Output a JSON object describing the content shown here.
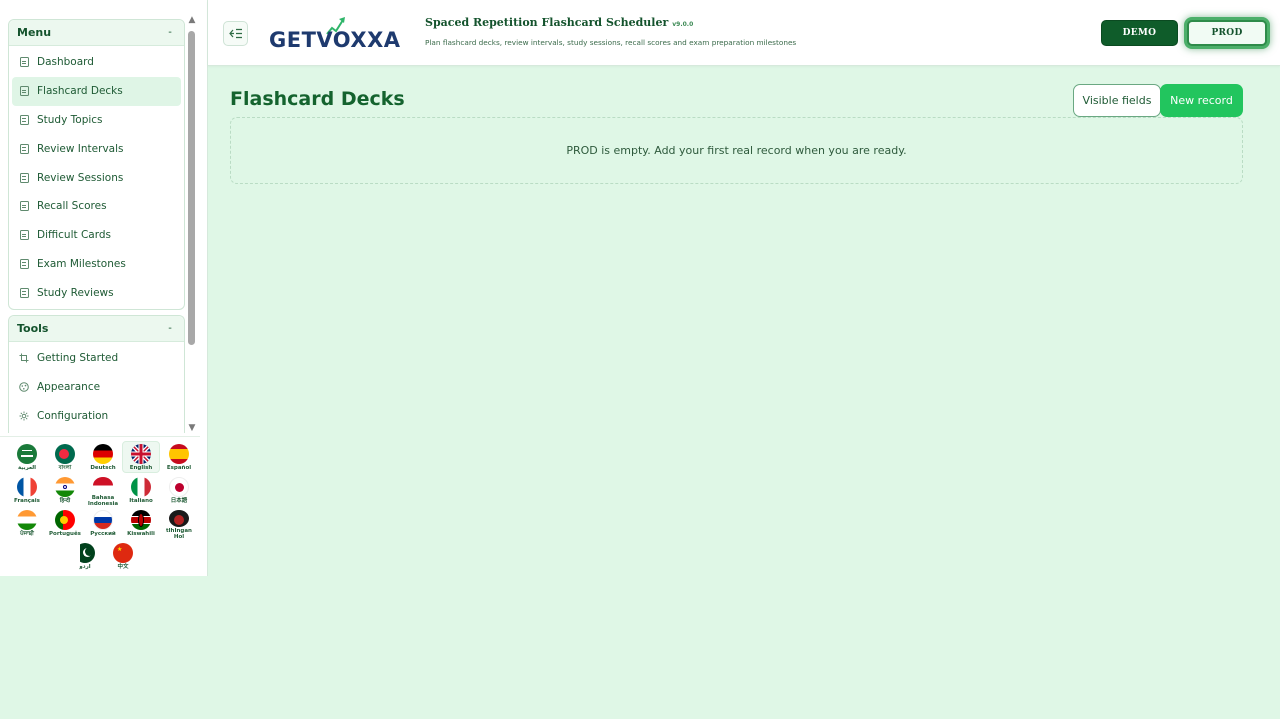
{
  "sidebar": {
    "menu": {
      "title": "Menu",
      "toggle": "-",
      "items": [
        {
          "label": "Dashboard"
        },
        {
          "label": "Flashcard Decks",
          "active": true
        },
        {
          "label": "Study Topics"
        },
        {
          "label": "Review Intervals"
        },
        {
          "label": "Review Sessions"
        },
        {
          "label": "Recall Scores"
        },
        {
          "label": "Difficult Cards"
        },
        {
          "label": "Exam Milestones"
        },
        {
          "label": "Study Reviews"
        }
      ]
    },
    "tools": {
      "title": "Tools",
      "toggle": "-",
      "items": [
        {
          "label": "Getting Started",
          "icon": "crop-icon"
        },
        {
          "label": "Appearance",
          "icon": "palette-icon"
        },
        {
          "label": "Configuration",
          "icon": "gear-icon"
        }
      ]
    },
    "languages": [
      {
        "name": "العربية",
        "code": "ar"
      },
      {
        "name": "বাংলা",
        "code": "bn"
      },
      {
        "name": "Deutsch",
        "code": "de"
      },
      {
        "name": "English",
        "code": "en",
        "selected": true
      },
      {
        "name": "Español",
        "code": "es"
      },
      {
        "name": "Français",
        "code": "fr"
      },
      {
        "name": "हिन्दी",
        "code": "hi"
      },
      {
        "name": "Bahasa Indonesia",
        "code": "id"
      },
      {
        "name": "Italiano",
        "code": "it"
      },
      {
        "name": "日本語",
        "code": "ja"
      },
      {
        "name": "ਪੰਜਾਬੀ",
        "code": "pa"
      },
      {
        "name": "Português",
        "code": "pt"
      },
      {
        "name": "Русский",
        "code": "ru"
      },
      {
        "name": "Kiswahili",
        "code": "sw"
      },
      {
        "name": "tlhIngan Hol",
        "code": "tlh"
      },
      {
        "name": "اردو",
        "code": "ur"
      },
      {
        "name": "中文",
        "code": "zh"
      }
    ]
  },
  "header": {
    "logo_text": "GETVOXXA",
    "app_title": "Spaced Repetition Flashcard Scheduler",
    "app_version": "v9.0.0",
    "app_subtitle": "Plan flashcard decks, review intervals, study sessions, recall scores and exam preparation milestones",
    "env_demo": "DEMO",
    "env_prod": "PROD",
    "active_env": "PROD"
  },
  "main": {
    "title": "Flashcard Decks",
    "visible_fields_label": "Visible fields",
    "new_record_label": "New record",
    "empty_message": "PROD is empty. Add your first real record when you are ready."
  },
  "colors": {
    "accent": "#22c55e",
    "brand_dark": "#0f5c2a",
    "title_green": "#14632e",
    "background": "#dff7e6"
  }
}
